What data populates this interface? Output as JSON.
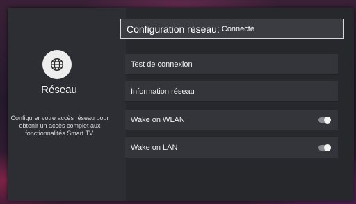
{
  "category": {
    "icon": "globe-icon",
    "title": "Réseau",
    "description": "Configurer votre accès réseau pour obtenir un accès complet aux fonctionnalités Smart TV."
  },
  "header": {
    "title": "Configuration réseau:",
    "status": "Connecté"
  },
  "menu": {
    "items": [
      {
        "label": "Test de connexion",
        "has_toggle": false
      },
      {
        "label": "Information réseau",
        "has_toggle": false
      },
      {
        "label": "Wake on WLAN",
        "has_toggle": true,
        "toggle_state": "off"
      },
      {
        "label": "Wake on LAN",
        "has_toggle": true,
        "toggle_state": "off"
      }
    ]
  },
  "colors": {
    "panel_bg": "#27292e",
    "item_bg": "#33353a",
    "text": "#f0f0f0",
    "toggle_off": "#8a8c90"
  }
}
